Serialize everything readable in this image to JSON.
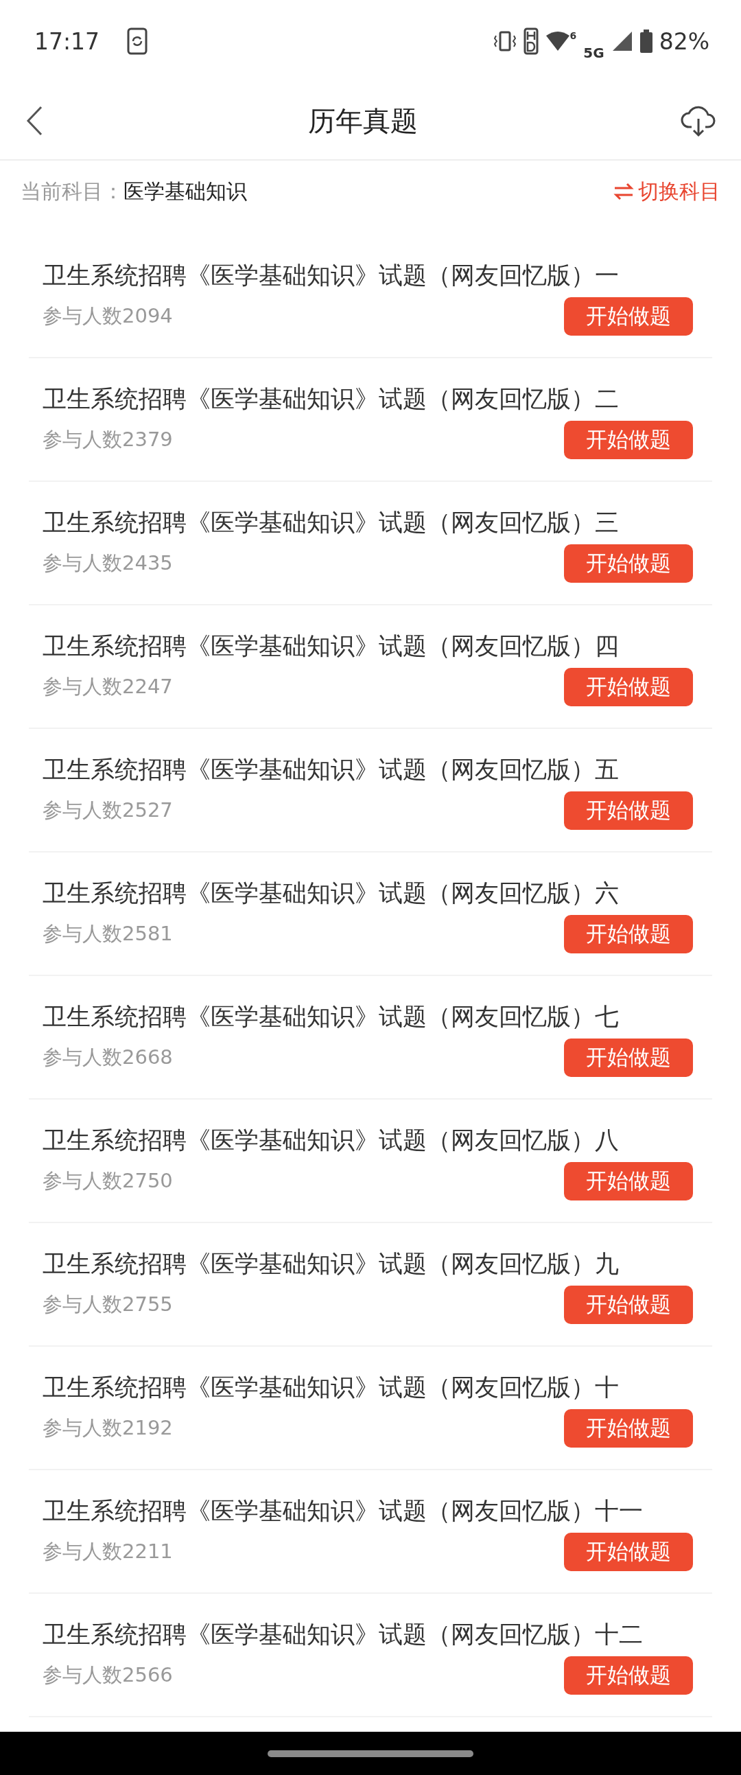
{
  "status_bar": {
    "time": "17:17",
    "wifi_badge": "6",
    "network": "5G",
    "battery": "82%"
  },
  "header": {
    "title": "历年真题"
  },
  "subject": {
    "label": "当前科目：",
    "value": "医学基础知识",
    "switch": "切换科目"
  },
  "papers": [
    {
      "title": "卫生系统招聘《医学基础知识》试题（网友回忆版）一",
      "count": "参与人数2094",
      "button": "开始做题"
    },
    {
      "title": "卫生系统招聘《医学基础知识》试题（网友回忆版）二",
      "count": "参与人数2379",
      "button": "开始做题"
    },
    {
      "title": "卫生系统招聘《医学基础知识》试题（网友回忆版）三",
      "count": "参与人数2435",
      "button": "开始做题"
    },
    {
      "title": "卫生系统招聘《医学基础知识》试题（网友回忆版）四",
      "count": "参与人数2247",
      "button": "开始做题"
    },
    {
      "title": "卫生系统招聘《医学基础知识》试题（网友回忆版）五",
      "count": "参与人数2527",
      "button": "开始做题"
    },
    {
      "title": "卫生系统招聘《医学基础知识》试题（网友回忆版）六",
      "count": "参与人数2581",
      "button": "开始做题"
    },
    {
      "title": "卫生系统招聘《医学基础知识》试题（网友回忆版）七",
      "count": "参与人数2668",
      "button": "开始做题"
    },
    {
      "title": "卫生系统招聘《医学基础知识》试题（网友回忆版）八",
      "count": "参与人数2750",
      "button": "开始做题"
    },
    {
      "title": "卫生系统招聘《医学基础知识》试题（网友回忆版）九",
      "count": "参与人数2755",
      "button": "开始做题"
    },
    {
      "title": "卫生系统招聘《医学基础知识》试题（网友回忆版）十",
      "count": "参与人数2192",
      "button": "开始做题"
    },
    {
      "title": "卫生系统招聘《医学基础知识》试题（网友回忆版）十一",
      "count": "参与人数2211",
      "button": "开始做题"
    },
    {
      "title": "卫生系统招聘《医学基础知识》试题（网友回忆版）十二",
      "count": "参与人数2566",
      "button": "开始做题"
    }
  ]
}
